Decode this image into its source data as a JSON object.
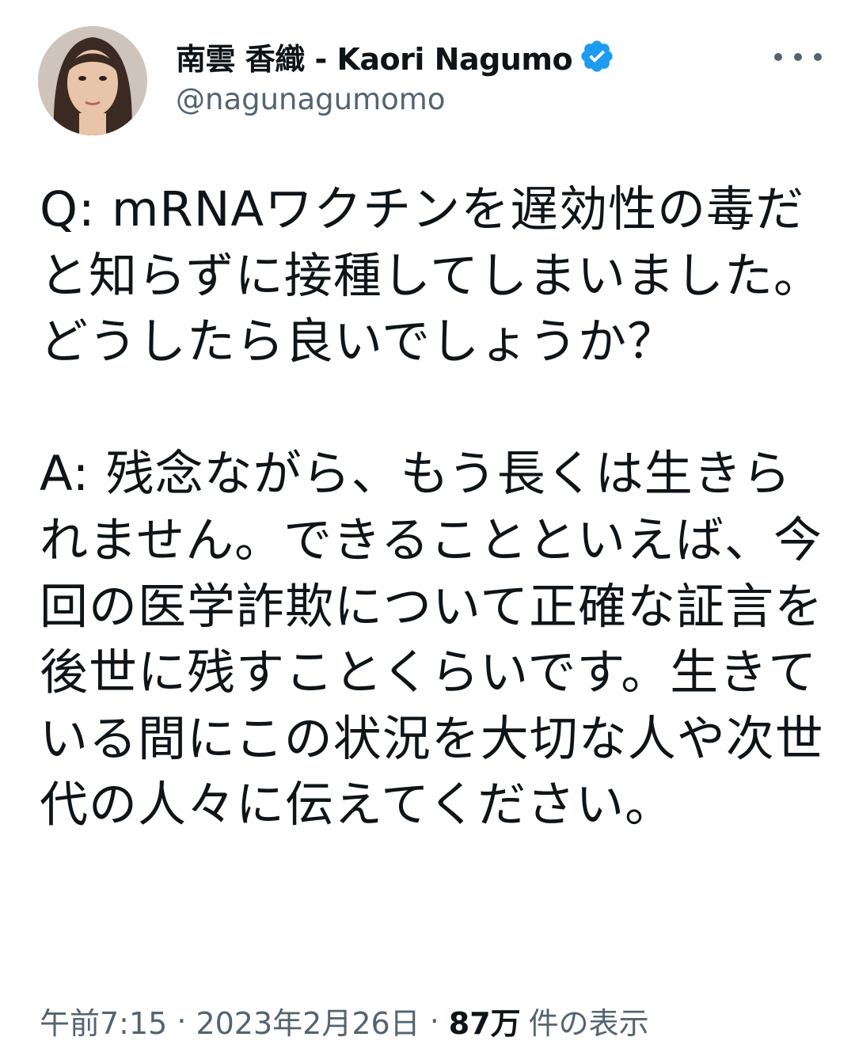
{
  "author": {
    "display_name": "南雲 香織 - Kaori Nagumo",
    "handle": "@nagunagumomo",
    "verified_icon": "verified-badge-icon",
    "verified_color": "#1d9bf0"
  },
  "tweet": {
    "text": "Q: mRNAワクチンを遅効性の毒だと知らずに接種してしまいました。どうしたら良いでしょうか？\n\nA: 残念ながら、もう長くは生きられません。できることといえば、今回の医学詐欺について正確な証言を後世に残すことくらいです。生きている間にこの状況を大切な人や次世代の人々に伝えてください。"
  },
  "meta": {
    "time": "午前7:15",
    "separator": "·",
    "date": "2023年2月26日",
    "views_count": "87万",
    "views_label": "件の表示"
  },
  "menu_icon": "more-options-icon"
}
